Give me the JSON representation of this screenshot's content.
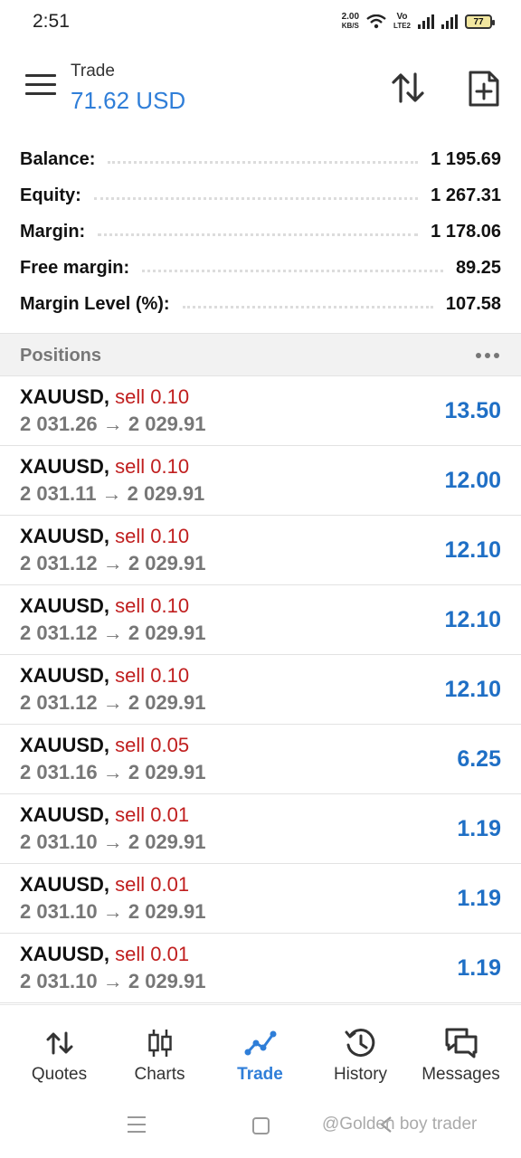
{
  "status_bar": {
    "time": "2:51",
    "net_speed_value": "2.00",
    "net_speed_unit": "KB/S",
    "volte_top": "Vo",
    "volte_bottom": "LTE2",
    "battery": "77"
  },
  "header": {
    "title": "Trade",
    "subtitle": "71.62 USD"
  },
  "summary": [
    {
      "label": "Balance:",
      "value": "1 195.69"
    },
    {
      "label": "Equity:",
      "value": "1 267.31"
    },
    {
      "label": "Margin:",
      "value": "1 178.06"
    },
    {
      "label": "Free margin:",
      "value": "89.25"
    },
    {
      "label": "Margin Level (%):",
      "value": "107.58"
    }
  ],
  "positions_section": {
    "title": "Positions"
  },
  "positions": [
    {
      "symbol": "XAUUSD,",
      "type": "sell 0.10",
      "prices": "2 031.26 → 2 029.91",
      "profit": "13.50"
    },
    {
      "symbol": "XAUUSD,",
      "type": "sell 0.10",
      "prices": "2 031.11 → 2 029.91",
      "profit": "12.00"
    },
    {
      "symbol": "XAUUSD,",
      "type": "sell 0.10",
      "prices": "2 031.12 → 2 029.91",
      "profit": "12.10"
    },
    {
      "symbol": "XAUUSD,",
      "type": "sell 0.10",
      "prices": "2 031.12 → 2 029.91",
      "profit": "12.10"
    },
    {
      "symbol": "XAUUSD,",
      "type": "sell 0.10",
      "prices": "2 031.12 → 2 029.91",
      "profit": "12.10"
    },
    {
      "symbol": "XAUUSD,",
      "type": "sell 0.05",
      "prices": "2 031.16 → 2 029.91",
      "profit": "6.25"
    },
    {
      "symbol": "XAUUSD,",
      "type": "sell 0.01",
      "prices": "2 031.10 → 2 029.91",
      "profit": "1.19"
    },
    {
      "symbol": "XAUUSD,",
      "type": "sell 0.01",
      "prices": "2 031.10 → 2 029.91",
      "profit": "1.19"
    },
    {
      "symbol": "XAUUSD,",
      "type": "sell 0.01",
      "prices": "2 031.10 → 2 029.91",
      "profit": "1.19"
    }
  ],
  "bottom_nav": [
    {
      "label": "Quotes",
      "icon": "quotes-icon",
      "active": false
    },
    {
      "label": "Charts",
      "icon": "charts-icon",
      "active": false
    },
    {
      "label": "Trade",
      "icon": "trade-icon",
      "active": true
    },
    {
      "label": "History",
      "icon": "history-icon",
      "active": false
    },
    {
      "label": "Messages",
      "icon": "messages-icon",
      "active": false
    }
  ],
  "watermark": "@Golden boy trader",
  "colors": {
    "accent": "#2f7ed8",
    "profit": "#1f6fc5",
    "sell": "#c01e1e"
  }
}
